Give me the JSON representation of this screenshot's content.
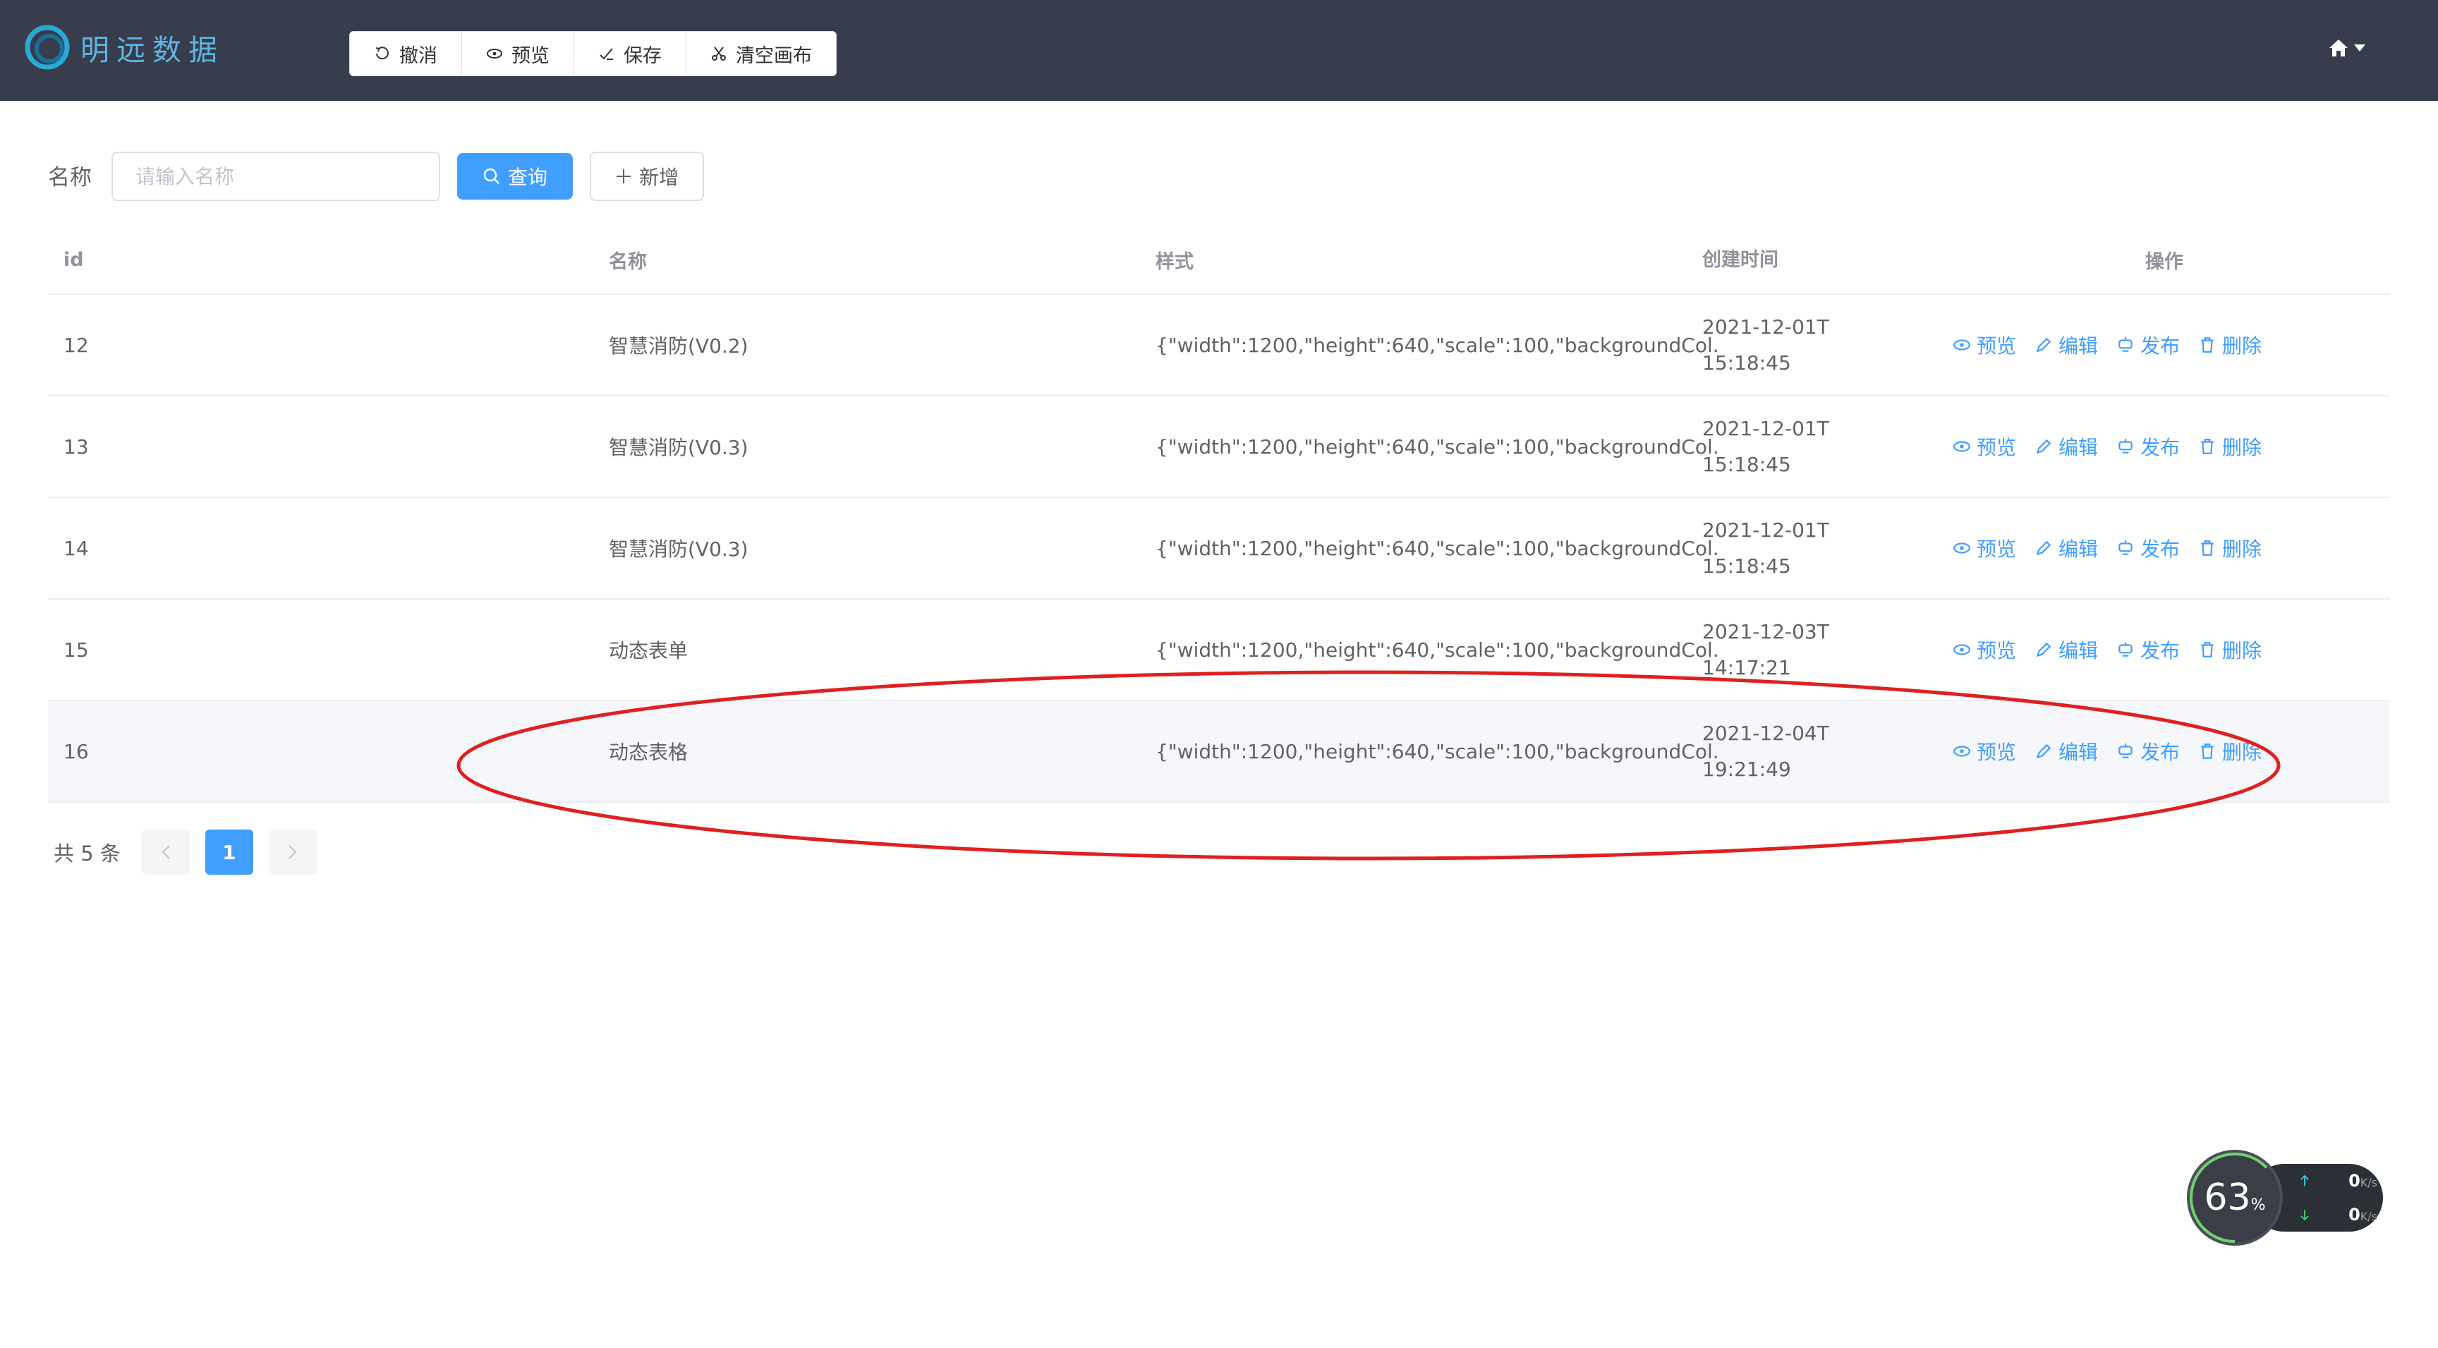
{
  "app": {
    "logo_text": "明远数据"
  },
  "toolbar": {
    "undo": "撤消",
    "preview": "预览",
    "save": "保存",
    "clear": "清空画布"
  },
  "search": {
    "label": "名称",
    "placeholder": "请输入名称",
    "query_label": "查询",
    "add_label": "新增"
  },
  "table": {
    "columns": [
      "id",
      "名称",
      "样式",
      "创建时间",
      "操作"
    ],
    "rows": [
      {
        "id": "12",
        "name": "智慧消防(V0.2)",
        "style": "{\"width\":1200,\"height\":640,\"scale\":100,\"backgroundCol...",
        "date": "2021-12-01T",
        "time": "15:18:45"
      },
      {
        "id": "13",
        "name": "智慧消防(V0.3)",
        "style": "{\"width\":1200,\"height\":640,\"scale\":100,\"backgroundCol...",
        "date": "2021-12-01T",
        "time": "15:18:45"
      },
      {
        "id": "14",
        "name": "智慧消防(V0.3)",
        "style": "{\"width\":1200,\"height\":640,\"scale\":100,\"backgroundCol...",
        "date": "2021-12-01T",
        "time": "15:18:45"
      },
      {
        "id": "15",
        "name": "动态表单",
        "style": "{\"width\":1200,\"height\":640,\"scale\":100,\"backgroundCol...",
        "date": "2021-12-03T",
        "time": "14:17:21"
      },
      {
        "id": "16",
        "name": "动态表格",
        "style": "{\"width\":1200,\"height\":640,\"scale\":100,\"backgroundCol...",
        "date": "2021-12-04T",
        "time": "19:21:49"
      }
    ],
    "actions": {
      "preview": "预览",
      "edit": "编辑",
      "publish": "发布",
      "delete": "删除"
    }
  },
  "pagination": {
    "total": "共 5 条",
    "current_page": "1"
  },
  "speed_widget": {
    "percent": "63",
    "percent_unit": "%",
    "upload": "0",
    "download": "0",
    "unit": "K/s"
  },
  "colors": {
    "header_bg": "#373d4c",
    "primary": "#409eff",
    "annotation": "#e02020"
  }
}
